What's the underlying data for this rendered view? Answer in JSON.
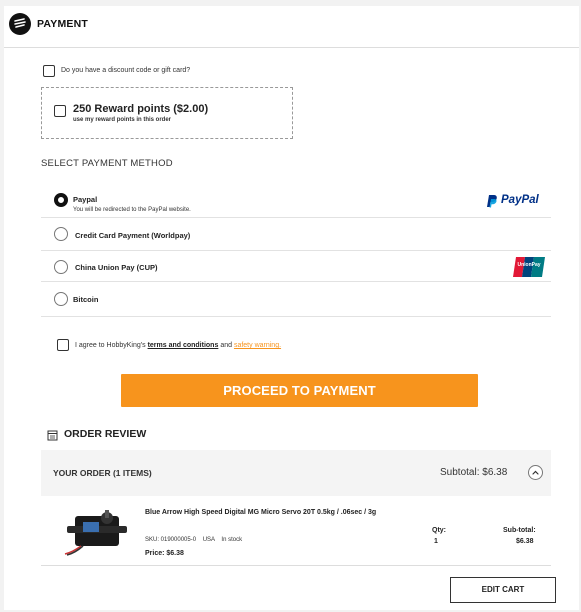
{
  "header": {
    "title": "PAYMENT"
  },
  "discount": {
    "label": "Do you have a discount code or gift card?"
  },
  "reward": {
    "points_label": "250 Reward points ($2.00)",
    "sub_label": "use my reward points in this order"
  },
  "payment_method": {
    "title": "SELECT PAYMENT METHOD",
    "options": [
      {
        "label": "Paypal",
        "note": "You will be redirected to the PayPal website.",
        "selected": true,
        "logo": "paypal-logo"
      },
      {
        "label": "Credit Card Payment (Worldpay)",
        "selected": false
      },
      {
        "label": "China Union Pay (CUP)",
        "selected": false,
        "logo": "unionpay-logo"
      },
      {
        "label": "Bitcoin",
        "selected": false
      }
    ],
    "paypal_logo_text": "PayPal",
    "unionpay_logo_text": "UnionPay"
  },
  "agree": {
    "prefix": "I agree to HobbyKing's",
    "terms_link": "terms and conditions",
    "middle": "and",
    "safety_link": "safety warning."
  },
  "proceed_button": "PROCEED TO PAYMENT",
  "order_review": {
    "title": "ORDER REVIEW",
    "your_order": "YOUR ORDER (1 ITEMS)",
    "subtotal": "Subtotal: $6.38",
    "item": {
      "name": "Blue Arrow High Speed Digital MG Micro Servo 20T 0.5kg / .06sec / 3g",
      "sku": "SKU: 019000005-0",
      "warehouse": "USA",
      "stock": "In stock",
      "price": "Price: $6.38",
      "qty_label": "Qty:",
      "qty": "1",
      "subtotal_label": "Sub-total:",
      "subtotal": "$6.38"
    },
    "edit_cart": "EDIT CART"
  },
  "colors": {
    "accent": "#f7941d",
    "paypal_dark": "#003087",
    "paypal_light": "#009cde"
  }
}
